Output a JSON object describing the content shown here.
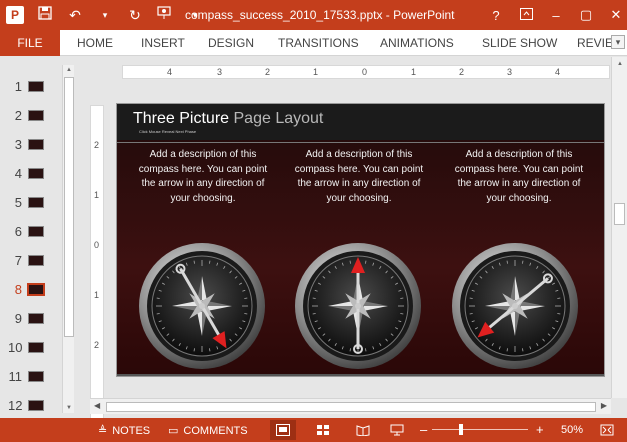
{
  "titlebar": {
    "app_icon": "P",
    "save_icon": "save-icon",
    "undo_icon": "undo-icon",
    "redo_icon": "redo-icon",
    "title": "compass_success_2010_17533.pptx - PowerPoint",
    "help": "?",
    "minimize": "–",
    "restore": "▢",
    "close": "✕"
  },
  "ribbon": {
    "file": "FILE",
    "tabs": [
      "HOME",
      "INSERT",
      "DESIGN",
      "TRANSITIONS",
      "ANIMATIONS",
      "SLIDE SHOW",
      "REVIEW"
    ]
  },
  "thumbnails": {
    "numbers": [
      "1",
      "2",
      "3",
      "4",
      "5",
      "6",
      "7",
      "8",
      "9",
      "10",
      "11",
      "12"
    ],
    "active_index": 8
  },
  "rulers": {
    "horizontal": [
      "4",
      "3",
      "2",
      "1",
      "0",
      "1",
      "2",
      "3",
      "4"
    ],
    "vertical": [
      "2",
      "1",
      "0",
      "1",
      "2"
    ]
  },
  "slide": {
    "title_main": "Three Picture",
    "title_light": "Page Layout",
    "subtitle": "Click Mouse Reveal Next Phase",
    "descriptions": [
      "Add a description of this compass here. You can point the arrow in any direction of your choosing.",
      "Add a description of this compass here. You can point the arrow in any direction of your choosing.",
      "Add a description of this compass here. You can point the arrow in any direction of your choosing."
    ],
    "compass_angles_deg": [
      150,
      0,
      230
    ]
  },
  "statusbar": {
    "notes": "NOTES",
    "comments": "COMMENTS",
    "zoom_minus": "–",
    "zoom_plus": "+",
    "zoom": "50%",
    "zoom_level_fraction": 0.3
  },
  "colors": {
    "accent": "#c43e1c",
    "slide_bg": "#2a0707",
    "arrow": "#e02020"
  }
}
